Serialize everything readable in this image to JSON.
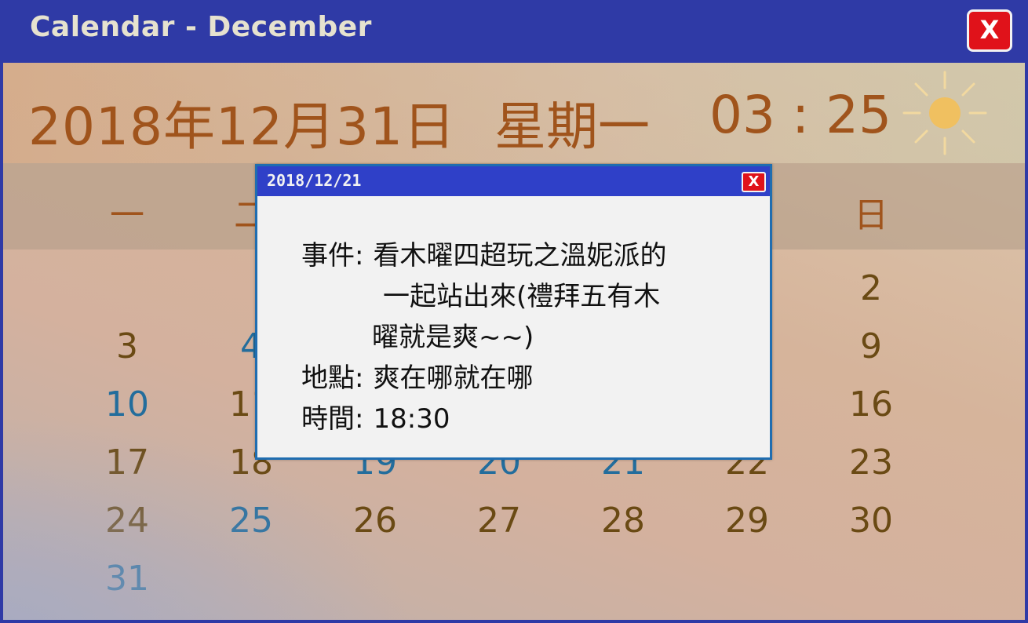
{
  "window": {
    "title": "Calendar - December",
    "close_label": "X"
  },
  "header": {
    "date": "2018年12月31日",
    "weekday": "星期一",
    "time": "03 : 25",
    "icon": "sun-icon",
    "sun_color": "#f0c060"
  },
  "weekdays": [
    "一",
    "二",
    "日"
  ],
  "days": {
    "d2": "2",
    "d3": "3",
    "d4": "4",
    "d9": "9",
    "d10": "10",
    "d11": "11",
    "d16": "16",
    "d17": "17",
    "d18": "18",
    "d19": "19",
    "d20": "20",
    "d21": "21",
    "d22": "22",
    "d23": "23",
    "d24": "24",
    "d25": "25",
    "d26": "26",
    "d27": "27",
    "d28": "28",
    "d29": "29",
    "d30": "30",
    "d31": "31"
  },
  "popup": {
    "title": "2018/12/21",
    "close_label": "X",
    "event_label": "事件:",
    "event_line1": "看木曜四超玩之溫妮派的",
    "event_line2": "一起站出來(禮拜五有木",
    "event_line3": "曜就是爽~~)",
    "location_label": "地點:",
    "location_value": "爽在哪就在哪",
    "time_label": "時間:",
    "time_value": "18:30"
  },
  "colors": {
    "titlebar": "#2f3aa6",
    "header_text": "#a0541c",
    "day_text": "#6a4a14",
    "day_blue": "#236d9c",
    "close_red": "#e0121a",
    "popup_titlebar": "#2f40c8"
  }
}
